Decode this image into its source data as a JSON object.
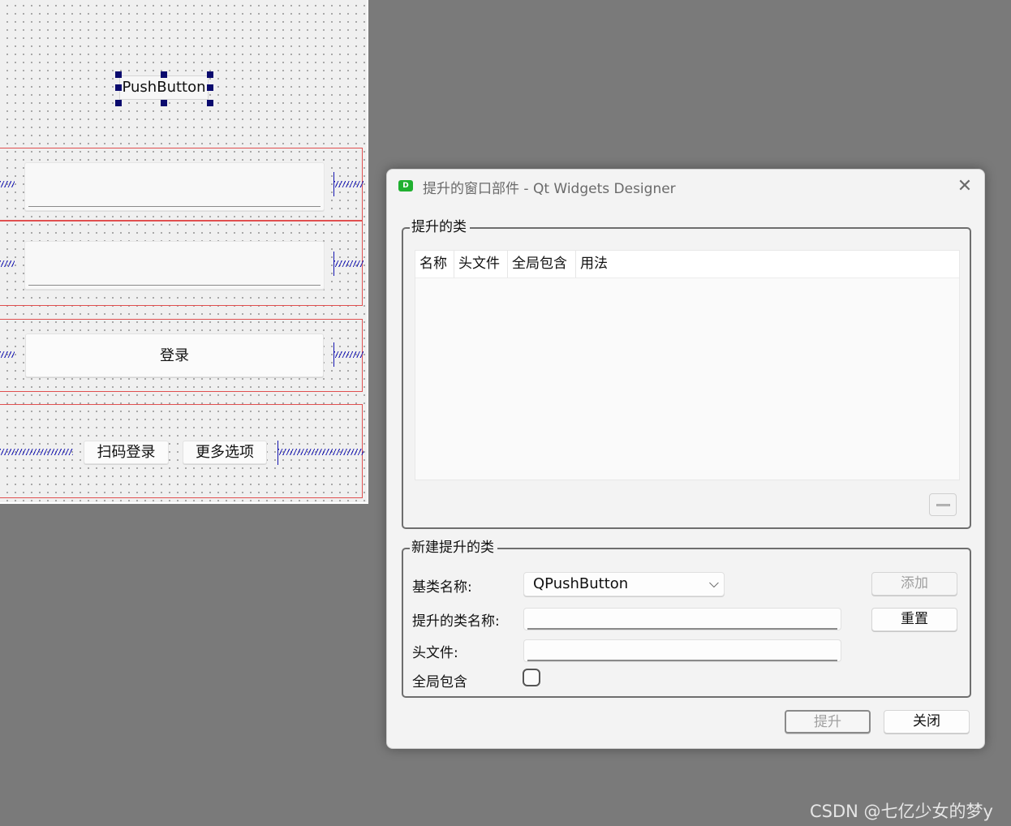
{
  "canvas": {
    "push_button_label": "PushButton",
    "login_button_label": "登录",
    "scan_login_button_label": "扫码登录",
    "more_options_button_label": "更多选项"
  },
  "dialog": {
    "title": "提升的窗口部件 - Qt Widgets Designer",
    "app_icon_letter": "D",
    "close_icon": "close-icon",
    "promoted_group": {
      "title": "提升的类",
      "columns": [
        "名称",
        "头文件",
        "全局包含",
        "用法"
      ],
      "rows": []
    },
    "new_group": {
      "title": "新建提升的类",
      "base_class_label": "基类名称:",
      "base_class_value": "QPushButton",
      "promoted_class_label": "提升的类名称:",
      "promoted_class_value": "",
      "header_file_label": "头文件:",
      "header_file_value": "",
      "global_include_label": "全局包含",
      "global_include_checked": false,
      "add_button": "添加",
      "reset_button": "重置"
    },
    "promote_button": "提升",
    "close_button": "关闭"
  },
  "watermark": "CSDN @七亿少女的梦y"
}
